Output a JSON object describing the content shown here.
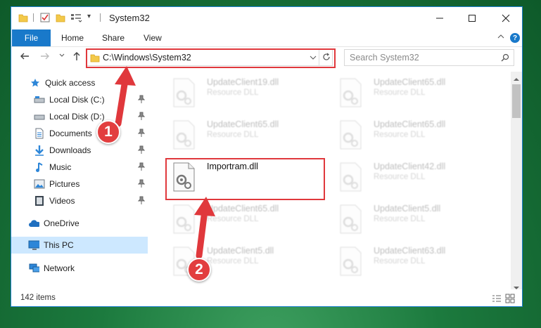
{
  "window": {
    "title": "System32",
    "controls": [
      "minimize-icon",
      "maximize-icon",
      "close-icon"
    ]
  },
  "ribbon": {
    "tabs": [
      "File",
      "Home",
      "Share",
      "View"
    ],
    "help_label": "?"
  },
  "navigation": {
    "address": "C:\\Windows\\System32",
    "search_placeholder": "Search System32"
  },
  "sidebar": {
    "items": [
      {
        "label": "Quick access",
        "icon": "star-icon"
      },
      {
        "label": "Local Disk (C:)",
        "icon": "drive-icon",
        "pinned": true
      },
      {
        "label": "Local Disk (D:)",
        "icon": "drive-icon",
        "pinned": true
      },
      {
        "label": "Documents",
        "icon": "documents-icon",
        "pinned": true
      },
      {
        "label": "Downloads",
        "icon": "downloads-icon",
        "pinned": true
      },
      {
        "label": "Music",
        "icon": "music-icon",
        "pinned": true
      },
      {
        "label": "Pictures",
        "icon": "pictures-icon",
        "pinned": true
      },
      {
        "label": "Videos",
        "icon": "videos-icon",
        "pinned": true
      },
      {
        "label": "OneDrive",
        "icon": "onedrive-icon"
      },
      {
        "label": "This PC",
        "icon": "pc-icon",
        "selected": true
      },
      {
        "label": "Network",
        "icon": "network-icon"
      }
    ]
  },
  "files": [
    {
      "name": "UpdateClient19.dll",
      "type": "Resource DLL"
    },
    {
      "name": "UpdateClient65.dll",
      "type": "Resource DLL"
    },
    {
      "name": "UpdateClient65.dll",
      "type": "Resource DLL"
    },
    {
      "name": "UpdateClient65.dll",
      "type": "Resource DLL"
    },
    {
      "name": "Importram.dll",
      "type": "",
      "highlighted": true
    },
    {
      "name": "UpdateClient42.dll",
      "type": "Resource DLL"
    },
    {
      "name": "UpdateClient65.dll",
      "type": "Resource DLL"
    },
    {
      "name": "UpdateClient5.dll",
      "type": "Resource DLL"
    },
    {
      "name": "UpdateClient5.dll",
      "type": "Resource DLL"
    },
    {
      "name": "UpdateClient63.dll",
      "type": "Resource DLL"
    }
  ],
  "status": {
    "item_count": "142 items"
  },
  "annotations": {
    "step1": "1",
    "step2": "2",
    "color": "#e0383c"
  }
}
